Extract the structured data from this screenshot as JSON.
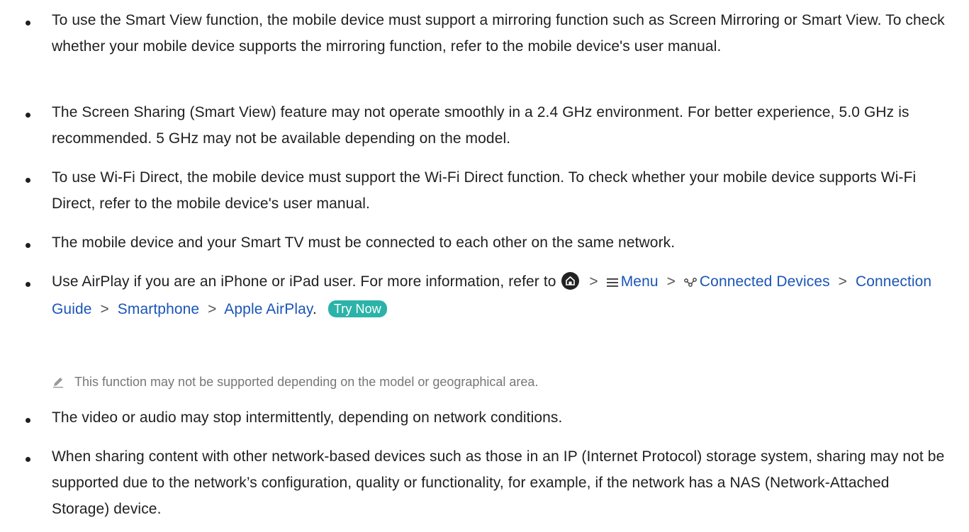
{
  "items": [
    "To use the Smart View function, the mobile device must support a mirroring function such as Screen Mirroring or Smart View. To check whether your mobile device supports the mirroring function, refer to the mobile device's user manual.",
    "The Screen Sharing (Smart View) feature may not operate smoothly in a 2.4 GHz environment. For better experience, 5.0 GHz is recommended. 5 GHz may not be available depending on the model.",
    "To use Wi-Fi Direct, the mobile device must support the Wi-Fi Direct function. To check whether your mobile device supports Wi-Fi Direct, refer to the mobile device's user manual.",
    "The mobile device and your Smart TV must be connected to each other on the same network."
  ],
  "airplay": {
    "intro": "Use AirPlay if you are an iPhone or iPad user. For more information, refer to",
    "sep": ">",
    "menu": "Menu",
    "connected_devices": "Connected Devices",
    "connection_guide": "Connection Guide",
    "smartphone": "Smartphone",
    "apple_airplay": "Apple AirPlay",
    "period": ".",
    "try_now": "Try Now"
  },
  "note": "This function may not be supported depending on the model or geographical area.",
  "items_after": [
    "The video or audio may stop intermittently, depending on network conditions.",
    "When sharing content with other network-based devices such as those in an IP (Internet Protocol) storage system, sharing may not be supported due to the network’s configuration, quality or functionality, for example, if the network has a NAS (Network-Attached Storage) device."
  ],
  "colors": {
    "link": "#1a55b7",
    "try_now_bg": "#2bb3a8",
    "note_text": "#777777"
  }
}
